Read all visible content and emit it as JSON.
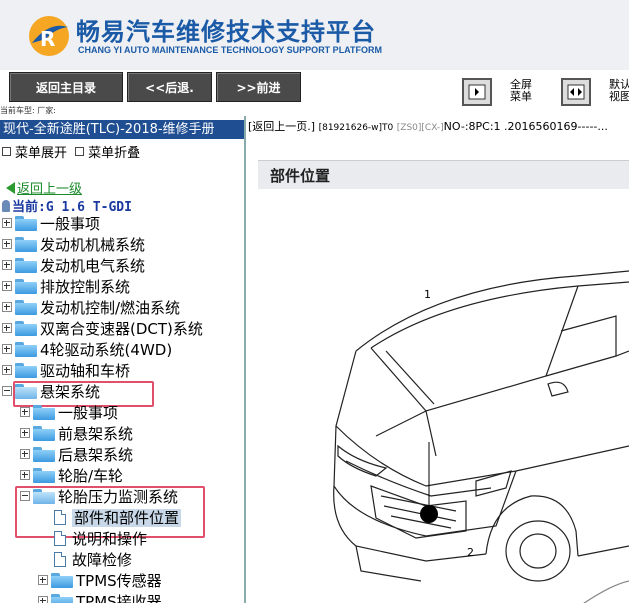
{
  "header": {
    "title": "畅易汽车维修技术支持平台",
    "subtitle": "CHANG YI AUTO MAINTENANCE TECHNOLOGY SUPPORT PLATFORM"
  },
  "toolbar": {
    "main_label": "返回主目录",
    "back_label": "<<后退.",
    "forward_label": ">>前进",
    "fullscreen_label_1": "全屏",
    "fullscreen_label_2": "菜单",
    "default_label_1": "默认",
    "default_label_2": "视图"
  },
  "status_line": "当前车型:  厂家:",
  "left": {
    "manual_title": "现代-全新途胜(TLC)-2018-维修手册",
    "expand_label": "菜单展开",
    "collapse_label": "菜单折叠",
    "return_label": "返回上一级",
    "current_label": "当前:G 1.6 T-GDI",
    "tree": [
      {
        "label": "一般事项"
      },
      {
        "label": "发动机机械系统"
      },
      {
        "label": "发动机电气系统"
      },
      {
        "label": "排放控制系统"
      },
      {
        "label": "发动机控制/燃油系统"
      },
      {
        "label": "双离合变速器(DCT)系统"
      },
      {
        "label": "4轮驱动系统(4WD)"
      },
      {
        "label": "驱动轴和车桥"
      },
      {
        "label": "悬架系统"
      },
      {
        "label": "一般事项"
      },
      {
        "label": "前悬架系统"
      },
      {
        "label": "后悬架系统"
      },
      {
        "label": "轮胎/车轮"
      },
      {
        "label": "轮胎压力监测系统"
      },
      {
        "label": "部件和部件位置"
      },
      {
        "label": "说明和操作"
      },
      {
        "label": "故障检修"
      },
      {
        "label": "TPMS传感器"
      },
      {
        "label": "TPMS接收器"
      }
    ]
  },
  "right": {
    "breadcrumb_prefix": "[返回上一页.]",
    "breadcrumb_code": "[81921626-w]T0",
    "breadcrumb_gray": "[ZS0][CX-]",
    "breadcrumb_tail": "NO-:8PC:1 .2016560169-----...",
    "section_title": "部件位置",
    "callout_1": "1",
    "callout_2": "2"
  },
  "colors": {
    "brand_blue": "#1a5aa6",
    "manual_bar": "#1f4e92",
    "highlight_box": "#e0506a"
  }
}
